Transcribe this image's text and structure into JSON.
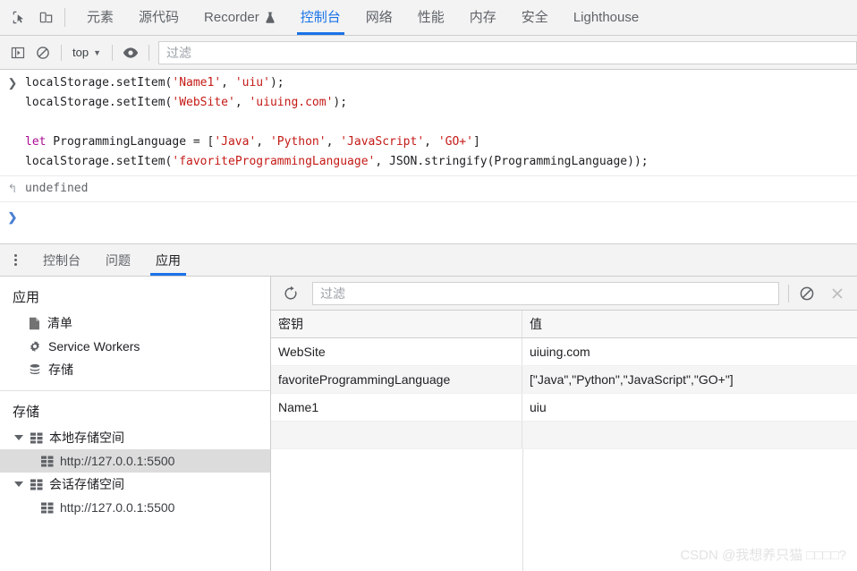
{
  "main_tabbar": {
    "inspect_icon": "inspect-cursor-icon",
    "device_icon": "device-toolbar-icon",
    "tabs": [
      {
        "label": "元素",
        "active": false
      },
      {
        "label": "源代码",
        "active": false
      },
      {
        "label": "Recorder",
        "active": false,
        "badge_icon": "flask-icon"
      },
      {
        "label": "控制台",
        "active": true
      },
      {
        "label": "网络",
        "active": false
      },
      {
        "label": "性能",
        "active": false
      },
      {
        "label": "内存",
        "active": false
      },
      {
        "label": "安全",
        "active": false
      },
      {
        "label": "Lighthouse",
        "active": false
      }
    ]
  },
  "console_toolbar": {
    "sidebar_toggle_icon": "console-sidebar-icon",
    "clear_icon": "clear-console-icon",
    "context_label": "top",
    "caret": "▼",
    "eye_icon": "live-expression-eye-icon",
    "filter_placeholder": "过滤"
  },
  "console": {
    "entries": [
      {
        "type": "input",
        "gutter": "❯",
        "lines": [
          [
            {
              "t": "localStorage.setItem(",
              "c": "plain"
            },
            {
              "t": "'Name1'",
              "c": "str"
            },
            {
              "t": ", ",
              "c": "plain"
            },
            {
              "t": "'uiu'",
              "c": "str"
            },
            {
              "t": ");",
              "c": "plain"
            }
          ],
          [
            {
              "t": "localStorage.setItem(",
              "c": "plain"
            },
            {
              "t": "'WebSite'",
              "c": "str"
            },
            {
              "t": ", ",
              "c": "plain"
            },
            {
              "t": "'uiuing.com'",
              "c": "str"
            },
            {
              "t": ");",
              "c": "plain"
            }
          ],
          [
            {
              "t": "",
              "c": "plain"
            }
          ],
          [
            {
              "t": "let",
              "c": "kw"
            },
            {
              "t": " ProgrammingLanguage = [",
              "c": "plain"
            },
            {
              "t": "'Java'",
              "c": "str"
            },
            {
              "t": ", ",
              "c": "plain"
            },
            {
              "t": "'Python'",
              "c": "str"
            },
            {
              "t": ", ",
              "c": "plain"
            },
            {
              "t": "'JavaScript'",
              "c": "str"
            },
            {
              "t": ", ",
              "c": "plain"
            },
            {
              "t": "'GO+'",
              "c": "str"
            },
            {
              "t": "]",
              "c": "plain"
            }
          ],
          [
            {
              "t": "localStorage.setItem(",
              "c": "plain"
            },
            {
              "t": "'favoriteProgrammingLanguage'",
              "c": "str"
            },
            {
              "t": ", JSON.stringify(ProgrammingLanguage));",
              "c": "plain"
            }
          ]
        ]
      }
    ],
    "result": {
      "gutter": "↰",
      "value": "undefined"
    },
    "prompt": {
      "gutter": "❯",
      "value": ""
    }
  },
  "drawer": {
    "kebab_icon": "more-options-icon",
    "tabs": [
      {
        "label": "控制台",
        "active": false
      },
      {
        "label": "问题",
        "active": false
      },
      {
        "label": "应用",
        "active": true
      }
    ]
  },
  "app_sidebar": {
    "application": {
      "title": "应用",
      "items": [
        {
          "label": "清单",
          "icon": "manifest-document-icon"
        },
        {
          "label": "Service Workers",
          "icon": "gear-icon"
        },
        {
          "label": "存储",
          "icon": "database-stack-icon"
        }
      ]
    },
    "storage": {
      "title": "存储",
      "groups": [
        {
          "label": "本地存储空间",
          "icon": "table-grid-icon",
          "expanded": true,
          "children": [
            {
              "label": "http://127.0.0.1:5500",
              "icon": "table-grid-icon",
              "selected": true
            }
          ]
        },
        {
          "label": "会话存储空间",
          "icon": "table-grid-icon",
          "expanded": true,
          "children": [
            {
              "label": "http://127.0.0.1:5500",
              "icon": "table-grid-icon",
              "selected": false
            }
          ]
        }
      ]
    }
  },
  "storage_panel": {
    "toolbar": {
      "refresh_icon": "refresh-icon",
      "filter_placeholder": "过滤",
      "clear_all_icon": "clear-all-icon",
      "delete_icon": "delete-selected-x-icon"
    },
    "table": {
      "columns": [
        "密钥",
        "值"
      ],
      "rows": [
        {
          "key": "WebSite",
          "value": "uiuing.com"
        },
        {
          "key": "favoriteProgrammingLanguage",
          "value": "[\"Java\",\"Python\",\"JavaScript\",\"GO+\"]"
        },
        {
          "key": "Name1",
          "value": "uiu"
        }
      ]
    }
  },
  "watermark": {
    "text": "CSDN @我想养只猫 □□□□?"
  },
  "colors": {
    "accent": "#1a73e8",
    "toolbar_bg": "#f3f3f3",
    "border": "#cdcdcd",
    "string_token": "#c41a16",
    "keyword_token": "#aa0d91",
    "selected_row_bg": "#dcdcdc"
  }
}
